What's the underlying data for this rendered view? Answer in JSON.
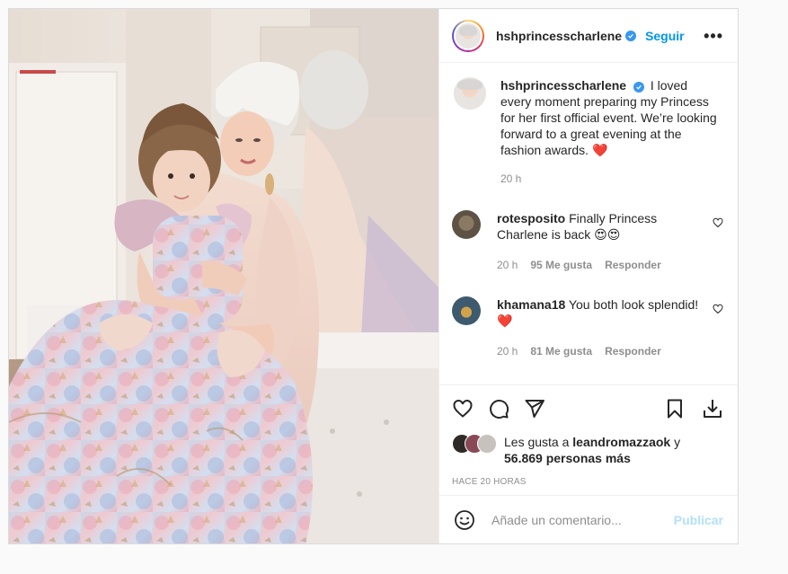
{
  "post": {
    "username": "hshprincesscharlene",
    "follow_label": "Seguir",
    "more_label": "•••",
    "caption": "I loved every moment preparing my Princess for her first official event. We’re looking forward to a great evening at the fashion awards. ❤️",
    "caption_time": "20 h"
  },
  "comments": [
    {
      "username": "rotesposito",
      "text": "Finally Princess Charlene is back 😍😍",
      "time": "20 h",
      "likes": "95 Me gusta",
      "reply_label": "Responder"
    },
    {
      "username": "khamana18",
      "text": "You both look splendid!❤️",
      "time": "20 h",
      "likes": "81 Me gusta",
      "reply_label": "Responder"
    }
  ],
  "likes": {
    "prefix": "Les gusta a",
    "user": "leandromazzaok",
    "conjunction": "y",
    "others": "56.869 personas más"
  },
  "time_ago": "HACE 20 HORAS",
  "add_comment": {
    "placeholder": "Añade un comentario...",
    "publish_label": "Publicar"
  },
  "colors": {
    "accent": "#0095f6",
    "publish_disabled": "#b2dffc",
    "verified": "#3897f0",
    "heart": "#ed4956"
  },
  "icons": [
    "heart-icon",
    "comment-icon",
    "share-icon",
    "bookmark-icon",
    "download-icon",
    "emoji-icon",
    "verified-badge-icon",
    "more-options-icon"
  ]
}
